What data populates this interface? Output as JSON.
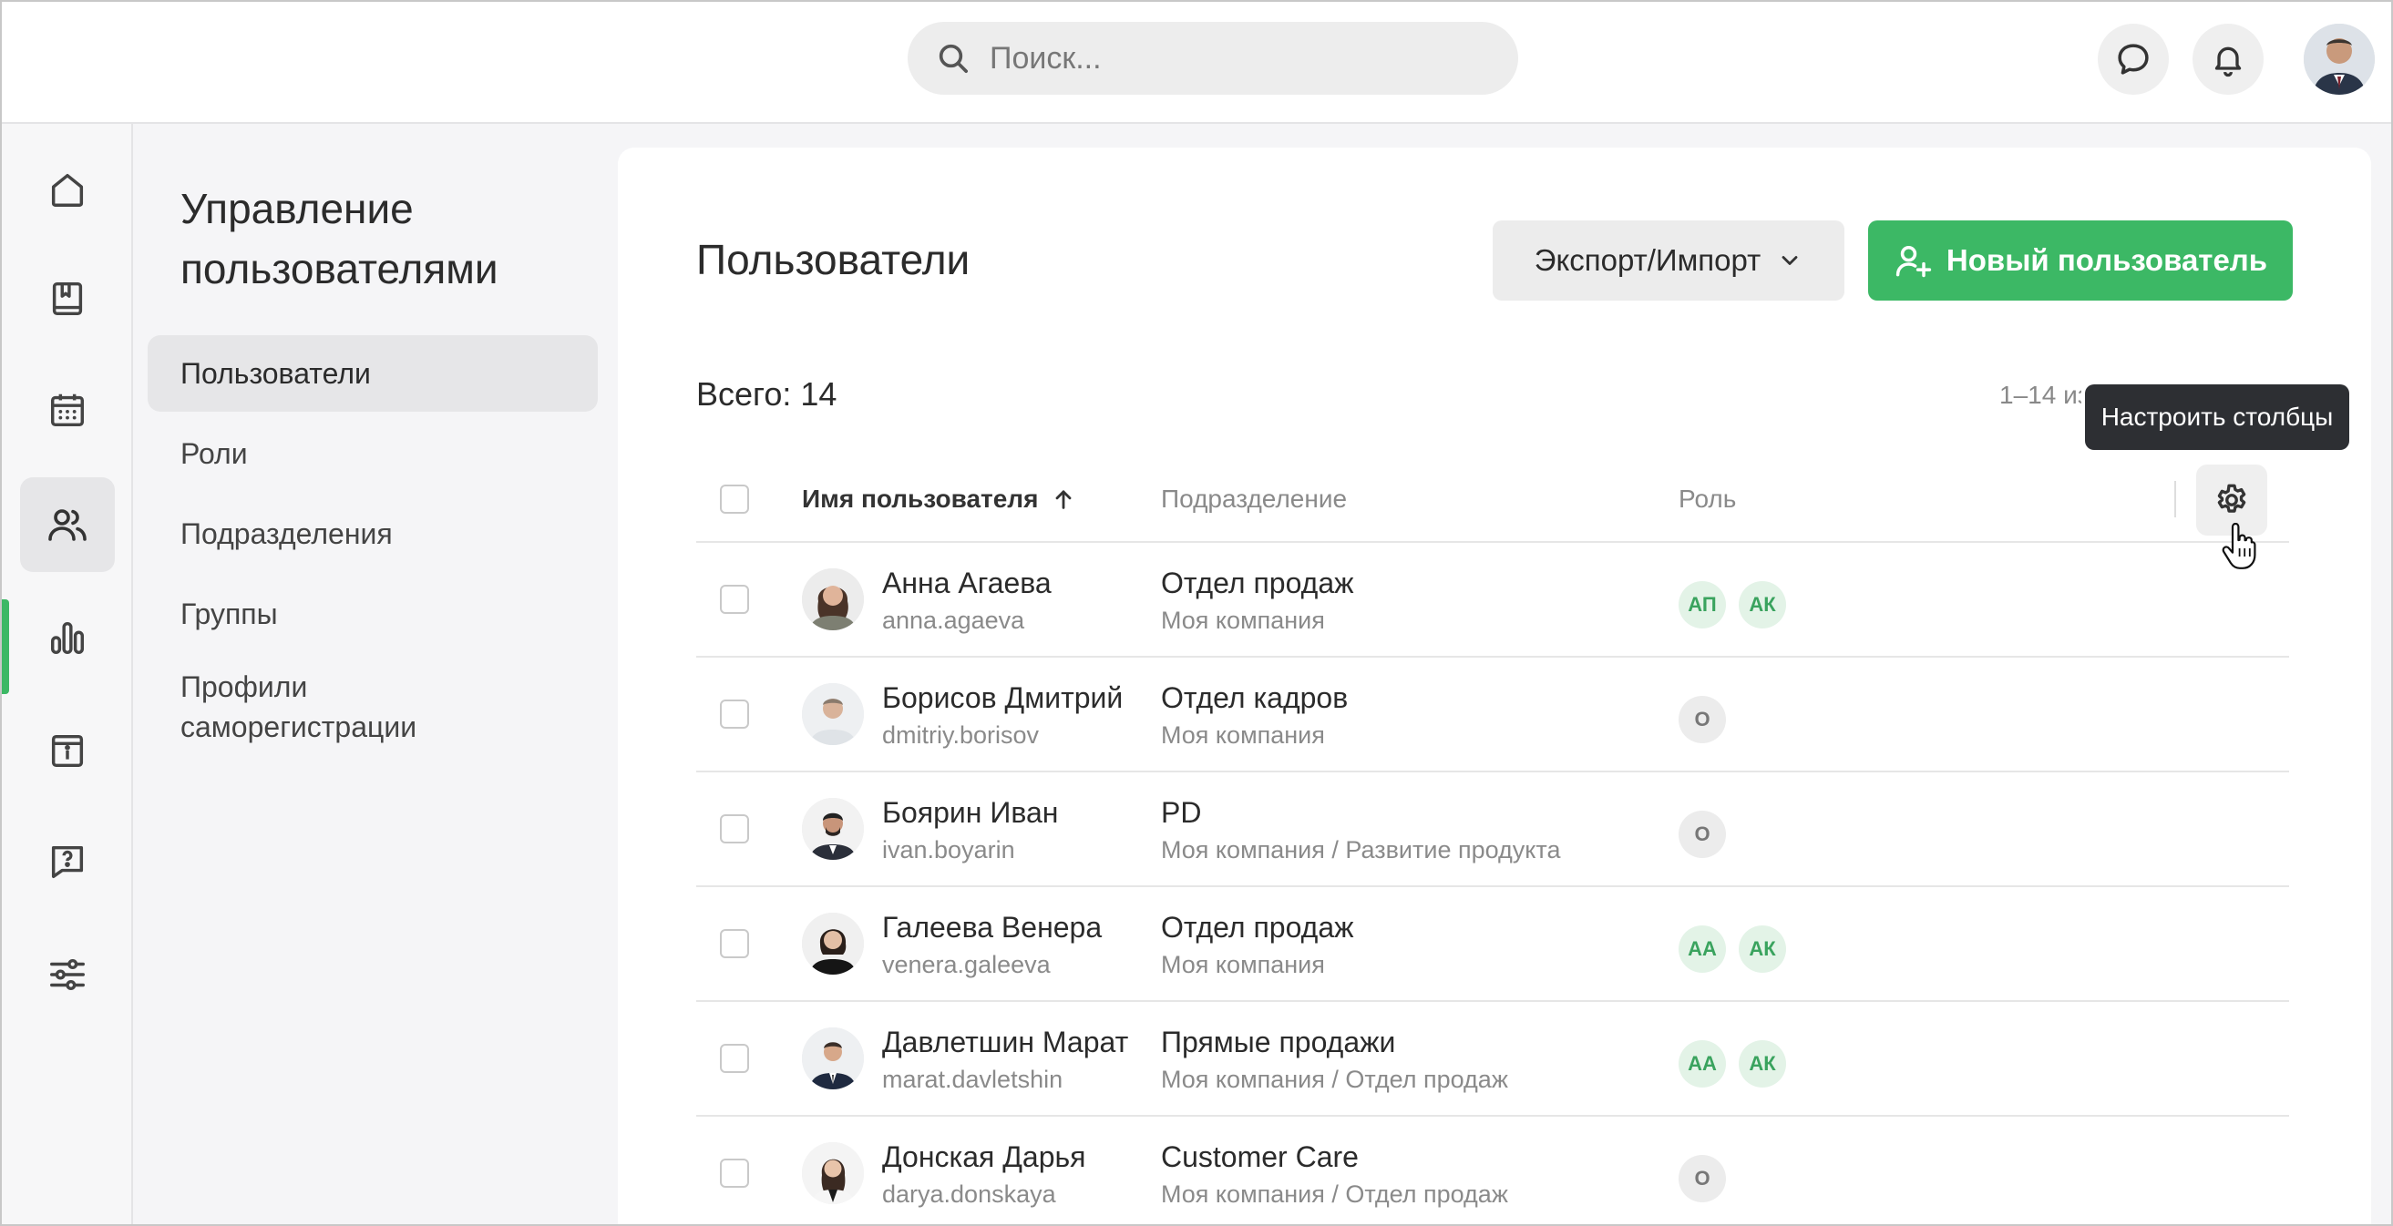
{
  "search": {
    "placeholder": "Поиск..."
  },
  "colors": {
    "accent": "#3cb865",
    "badge_bg": "#e3f3e7",
    "badge_text": "#3aa35e"
  },
  "rail": {
    "items": [
      {
        "icon": "home-icon"
      },
      {
        "icon": "book-icon"
      },
      {
        "icon": "calendar-icon"
      },
      {
        "icon": "users-icon",
        "active": true
      },
      {
        "icon": "bar-chart-icon"
      },
      {
        "icon": "info-box-icon"
      },
      {
        "icon": "help-chat-icon"
      },
      {
        "icon": "sliders-icon"
      }
    ]
  },
  "subnav": {
    "title": "Управление пользователями",
    "items": [
      {
        "label": "Пользователи",
        "active": true
      },
      {
        "label": "Роли"
      },
      {
        "label": "Подразделения"
      },
      {
        "label": "Группы"
      },
      {
        "label": "Профили саморегистрации"
      }
    ]
  },
  "main": {
    "title": "Пользователи",
    "export_label": "Экспорт/Импорт",
    "new_user_label": "Новый пользователь",
    "total": "Всего: 14",
    "paging": "1–14 из 14",
    "tooltip": "Настроить столбцы",
    "columns": {
      "name": "Имя пользователя",
      "department": "Подразделение",
      "role": "Роль"
    },
    "rows": [
      {
        "name": "Анна Агаева",
        "login": "anna.agaeva",
        "department": "Отдел продаж",
        "path": "Моя компания",
        "roles": [
          "АП",
          "АК"
        ]
      },
      {
        "name": "Борисов Дмитрий",
        "login": "dmitriy.borisov",
        "department": "Отдел кадров",
        "path": "Моя компания",
        "roles": [
          "О"
        ]
      },
      {
        "name": "Боярин Иван",
        "login": "ivan.boyarin",
        "department": "PD",
        "path": "Моя компания / Развитие продукта",
        "roles": [
          "О"
        ]
      },
      {
        "name": "Галеева Венера",
        "login": "venera.galeeva",
        "department": "Отдел продаж",
        "path": "Моя компания",
        "roles": [
          "АА",
          "АК"
        ]
      },
      {
        "name": "Давлетшин Марат",
        "login": "marat.davletshin",
        "department": "Прямые продажи",
        "path": "Моя компания / Отдел продаж",
        "roles": [
          "АА",
          "АК"
        ]
      },
      {
        "name": "Донская Дарья",
        "login": "darya.donskaya",
        "department": "Customer Care",
        "path": "Моя компания / Отдел продаж",
        "roles": [
          "О"
        ]
      }
    ]
  }
}
